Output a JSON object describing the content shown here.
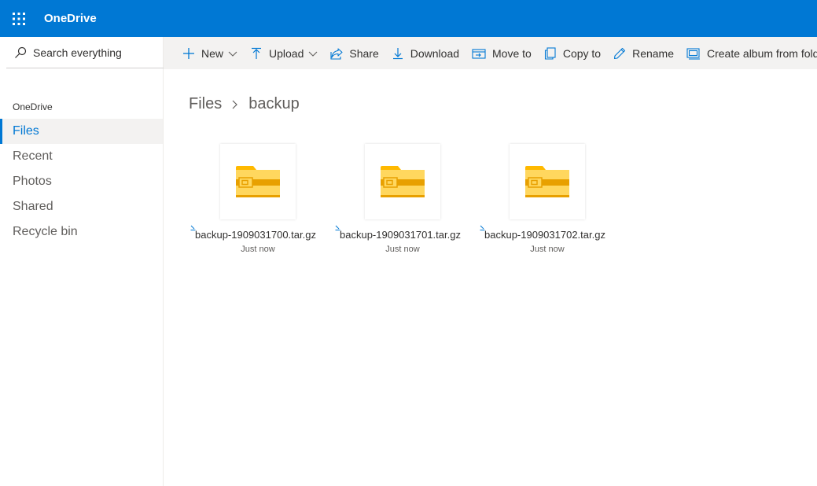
{
  "app": {
    "title": "OneDrive"
  },
  "search": {
    "placeholder": "Search everything"
  },
  "nav": {
    "heading": "OneDrive",
    "items": [
      {
        "label": "Files",
        "active": true
      },
      {
        "label": "Recent"
      },
      {
        "label": "Photos"
      },
      {
        "label": "Shared"
      },
      {
        "label": "Recycle bin"
      }
    ]
  },
  "commands": {
    "new": "New",
    "upload": "Upload",
    "share": "Share",
    "download": "Download",
    "move_to": "Move to",
    "copy_to": "Copy to",
    "rename": "Rename",
    "create_album": "Create album from folder"
  },
  "breadcrumb": [
    "Files",
    "backup"
  ],
  "files": [
    {
      "name": "backup-1909031700.tar.gz",
      "modified": "Just now",
      "icon": "zip-folder-icon"
    },
    {
      "name": "backup-1909031701.tar.gz",
      "modified": "Just now",
      "icon": "zip-folder-icon"
    },
    {
      "name": "backup-1909031702.tar.gz",
      "modified": "Just now",
      "icon": "zip-folder-icon"
    }
  ],
  "colors": {
    "brand": "#0078d4",
    "accent_text": "#0078d4",
    "folder": "#ffd75e",
    "folder_dark": "#e8a000"
  }
}
